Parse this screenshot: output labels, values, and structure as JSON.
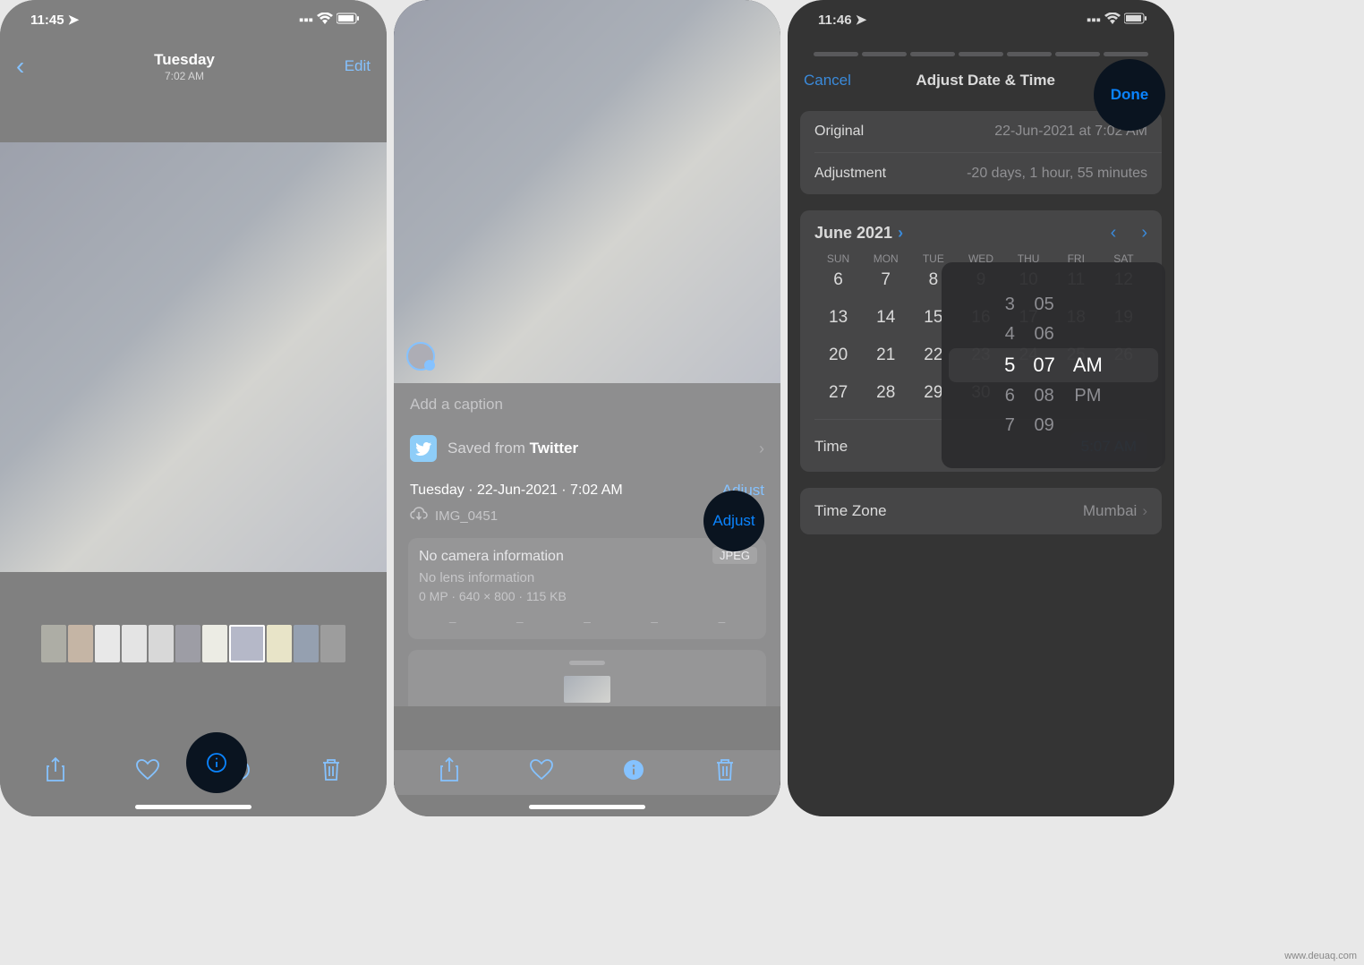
{
  "watermark": "www.deuaq.com",
  "phone1": {
    "status": {
      "time": "11:45",
      "loc_icon": "➤"
    },
    "nav": {
      "title": "Tuesday",
      "subtitle": "7:02 AM",
      "edit": "Edit"
    },
    "highlight": "info-icon"
  },
  "phone2": {
    "caption_placeholder": "Add a caption",
    "source": {
      "prefix": "Saved from ",
      "app": "Twitter"
    },
    "date_line": "Tuesday · 22-Jun-2021 · 7:02 AM",
    "adjust": "Adjust",
    "filename": "IMG_0451",
    "camera": {
      "line1": "No camera information",
      "line2": "No lens information",
      "line3": "0 MP  ·  640 × 800  ·  115 KB",
      "badge": "JPEG"
    },
    "highlight": "adjust-button"
  },
  "phone3": {
    "status": {
      "time": "11:46",
      "loc_icon": "➤"
    },
    "header": {
      "cancel": "Cancel",
      "title": "Adjust Date & Time",
      "done": "Done"
    },
    "rows": {
      "original_label": "Original",
      "original_value": "22-Jun-2021 at 7:02 AM",
      "adjustment_label": "Adjustment",
      "adjustment_value": "-20 days, 1 hour, 55 minutes"
    },
    "calendar": {
      "month": "June 2021",
      "weekdays": [
        "SUN",
        "MON",
        "TUE",
        "WED",
        "THU",
        "FRI",
        "SAT"
      ],
      "weeks": [
        [
          "",
          "",
          "",
          "",
          "",
          "",
          ""
        ],
        [
          "6",
          "7",
          "8",
          "9",
          "10",
          "11",
          "12"
        ],
        [
          "13",
          "14",
          "15",
          "16",
          "17",
          "18",
          "19"
        ],
        [
          "20",
          "21",
          "22",
          "23",
          "24",
          "25",
          "26"
        ],
        [
          "27",
          "28",
          "29",
          "30",
          "",
          "",
          ""
        ]
      ],
      "time_label": "Time",
      "time_value": "5:07 AM"
    },
    "time_picker": {
      "hours": [
        "3",
        "4",
        "5",
        "6",
        "7"
      ],
      "minutes": [
        "05",
        "06",
        "07",
        "08",
        "09"
      ],
      "ampm": [
        "AM",
        "PM"
      ],
      "selected": {
        "hour": "5",
        "minute": "07",
        "ampm": "AM"
      }
    },
    "timezone": {
      "label": "Time Zone",
      "value": "Mumbai"
    },
    "highlight": "done-button"
  }
}
